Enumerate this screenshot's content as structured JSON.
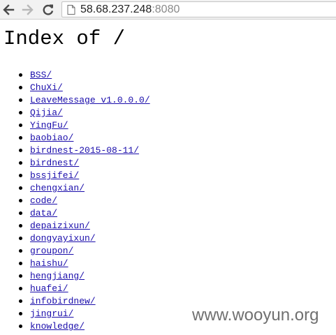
{
  "browser": {
    "url_host": "58.68.237.248",
    "url_port": ":8080",
    "icons": {
      "back": "arrow-left",
      "forward": "arrow-right",
      "reload": "reload",
      "page": "page"
    }
  },
  "page": {
    "title": "Index of /",
    "entries": [
      "BSS/",
      "ChuXi/",
      "LeaveMessage v1.0.0.0/",
      "Qijia/",
      "YingFu/",
      "baobiao/",
      "birdnest-2015-08-11/",
      "birdnest/",
      "bssjifei/",
      "chengxian/",
      "code/",
      "data/",
      "depaizixun/",
      "dongyayixun/",
      "groupon/",
      "haishu/",
      "hengjiang/",
      "huafei/",
      "infobirdnew/",
      "jingrui/",
      "knowledge/"
    ]
  },
  "watermark": "www.wooyun.org",
  "colors": {
    "link": "#1a0dab",
    "toolbar": "#f2f2f2",
    "watermark": "#707070"
  }
}
